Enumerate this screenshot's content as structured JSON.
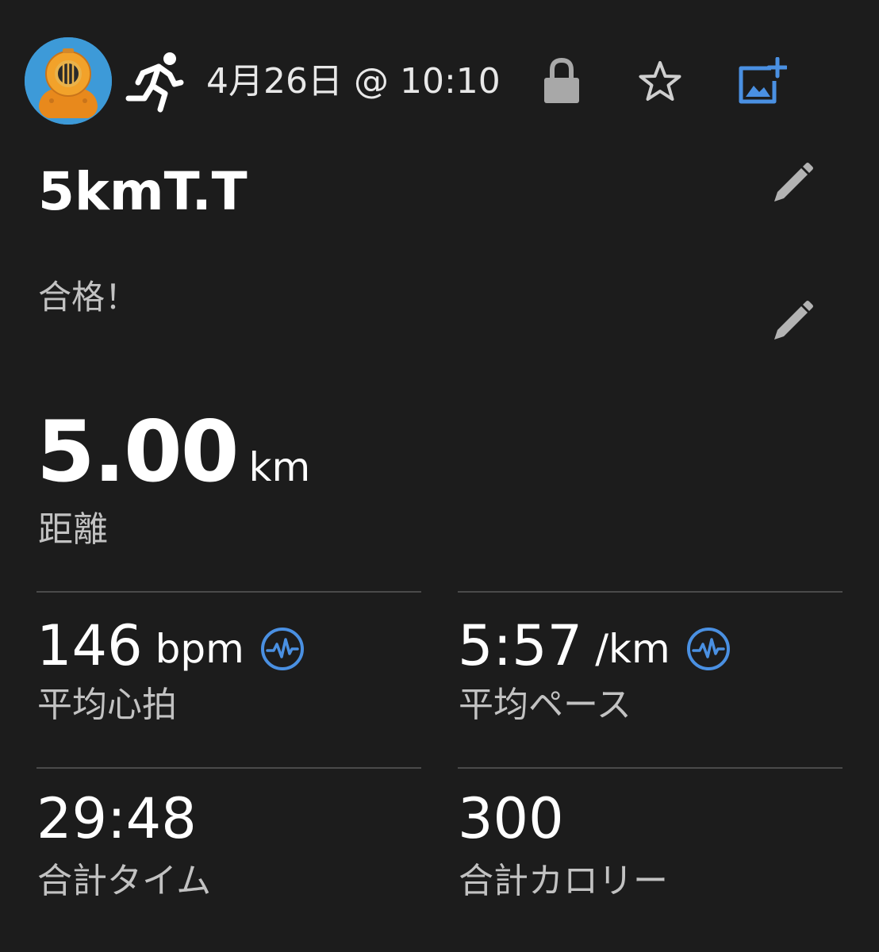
{
  "header": {
    "avatar_icon": "diving-helmet-icon",
    "activity_icon": "running-icon",
    "date_time": "4月26日 @ 10:10",
    "lock_icon": "lock-icon",
    "star_icon": "star-outline-icon",
    "add_photo_icon": "add-photo-icon",
    "accent_color": "#4a90e2"
  },
  "activity": {
    "title": "5kmT.T",
    "description": "合格！"
  },
  "distance": {
    "value": "5.00",
    "unit": "km",
    "label": "距離"
  },
  "stats": {
    "heart_rate": {
      "value": "146",
      "unit": "bpm",
      "label": "平均心拍",
      "badge_icon": "heart-rate-icon"
    },
    "pace": {
      "value": "5:57",
      "unit": "/km",
      "label": "平均ペース",
      "badge_icon": "heart-rate-icon"
    },
    "total_time": {
      "value": "29:48",
      "label": "合計タイム"
    },
    "calories": {
      "value": "300",
      "label": "合計カロリー"
    }
  }
}
